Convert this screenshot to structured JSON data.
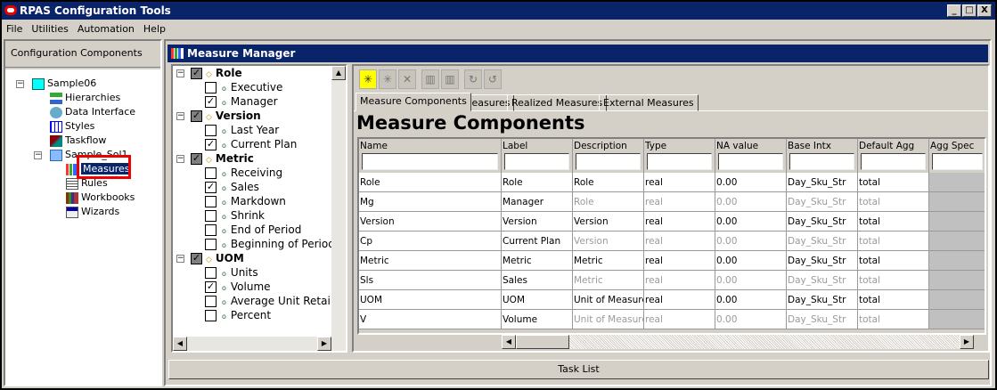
{
  "window": {
    "title": "RPAS Configuration Tools",
    "controls": [
      "_",
      "□",
      "X"
    ]
  },
  "menu": [
    "File",
    "Utilities",
    "Automation",
    "Help"
  ],
  "left_panel": {
    "header": "Configuration Components",
    "tree": [
      {
        "label": "Sample06",
        "level": 0,
        "icon": "folder-cyan-icon"
      },
      {
        "label": "Hierarchies",
        "level": 1,
        "icon": "hierarchy-icon"
      },
      {
        "label": "Data Interface",
        "level": 1,
        "icon": "data-interface-icon"
      },
      {
        "label": "Styles",
        "level": 1,
        "icon": "styles-grid-icon"
      },
      {
        "label": "Taskflow",
        "level": 1,
        "icon": "taskflow-icon"
      },
      {
        "label": "Sample_Sol1",
        "level": 1,
        "icon": "folder-blue-icon"
      },
      {
        "label": "Measures",
        "level": 2,
        "icon": "bar-chart-icon",
        "selected": true
      },
      {
        "label": "Rules",
        "level": 2,
        "icon": "rules-document-icon"
      },
      {
        "label": "Workbooks",
        "level": 2,
        "icon": "books-icon"
      },
      {
        "label": "Wizards",
        "level": 2,
        "icon": "wizard-window-icon"
      }
    ]
  },
  "measure_manager": {
    "title": "Measure Manager",
    "filter_tree": [
      {
        "label": "Role",
        "checked": true,
        "children": [
          {
            "label": "Executive",
            "checked": false
          },
          {
            "label": "Manager",
            "checked": true
          }
        ]
      },
      {
        "label": "Version",
        "checked": true,
        "children": [
          {
            "label": "Last Year",
            "checked": false
          },
          {
            "label": "Current Plan",
            "checked": true
          }
        ]
      },
      {
        "label": "Metric",
        "checked": true,
        "children": [
          {
            "label": "Receiving",
            "checked": false
          },
          {
            "label": "Sales",
            "checked": true
          },
          {
            "label": "Markdown",
            "checked": false
          },
          {
            "label": "Shrink",
            "checked": false
          },
          {
            "label": "End of Period",
            "checked": false
          },
          {
            "label": "Beginning of Period",
            "checked": false
          }
        ]
      },
      {
        "label": "UOM",
        "checked": true,
        "children": [
          {
            "label": "Units",
            "checked": false
          },
          {
            "label": "Volume",
            "checked": true
          },
          {
            "label": "Average Unit Retail",
            "checked": false
          },
          {
            "label": "Percent",
            "checked": false
          }
        ]
      }
    ],
    "toolbar": [
      "new-icon",
      "new-disabled-icon",
      "delete-icon",
      "import-icon",
      "export-icon",
      "undo-icon",
      "redo-icon"
    ],
    "tabs": [
      "Measure Components",
      "Measures",
      "Realized Measures",
      "External Measures"
    ],
    "active_tab": 0,
    "heading": "Measure Components",
    "columns": [
      "Name",
      "Label",
      "Description",
      "Type",
      "NA value",
      "Base Intx",
      "Default Agg",
      "Agg Spec"
    ],
    "rows": [
      {
        "cells": [
          "Role",
          "Role",
          "Role",
          "real",
          "0.00",
          "Day_Sku_Str",
          "total",
          ""
        ],
        "inherited": false
      },
      {
        "cells": [
          "Mg",
          "Manager",
          "Role",
          "real",
          "0.00",
          "Day_Sku_Str",
          "total",
          ""
        ],
        "inherited": true
      },
      {
        "cells": [
          "Version",
          "Version",
          "Version",
          "real",
          "0.00",
          "Day_Sku_Str",
          "total",
          ""
        ],
        "inherited": false
      },
      {
        "cells": [
          "Cp",
          "Current Plan",
          "Version",
          "real",
          "0.00",
          "Day_Sku_Str",
          "total",
          ""
        ],
        "inherited": true
      },
      {
        "cells": [
          "Metric",
          "Metric",
          "Metric",
          "real",
          "0.00",
          "Day_Sku_Str",
          "total",
          ""
        ],
        "inherited": false
      },
      {
        "cells": [
          "Sls",
          "Sales",
          "Metric",
          "real",
          "0.00",
          "Day_Sku_Str",
          "total",
          ""
        ],
        "inherited": true
      },
      {
        "cells": [
          "UOM",
          "UOM",
          "Unit of Measure",
          "real",
          "0.00",
          "Day_Sku_Str",
          "total",
          ""
        ],
        "inherited": false
      },
      {
        "cells": [
          "V",
          "Volume",
          "Unit of Measure",
          "real",
          "0.00",
          "Day_Sku_Str",
          "total",
          ""
        ],
        "inherited": true
      }
    ],
    "task_list": "Task List"
  },
  "colors": {
    "titlebar": "#0a246a",
    "highlight": "#e00000",
    "face": "#d4d0c8"
  }
}
